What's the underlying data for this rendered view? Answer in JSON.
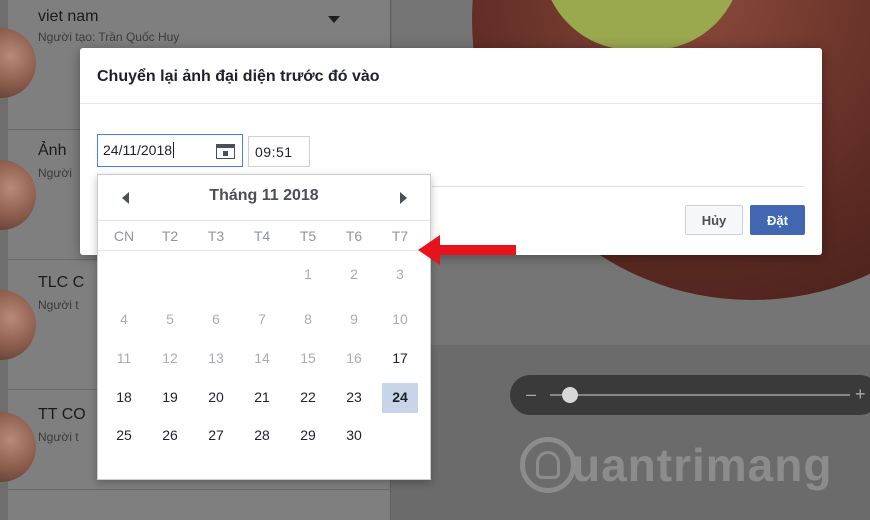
{
  "background": {
    "list_items": [
      {
        "name": "viet nam",
        "sub": "Người tạo: Trần Quốc Huy"
      },
      {
        "name": "Ảnh",
        "sub": "Người"
      },
      {
        "name": "TLC C",
        "sub": "Người t"
      },
      {
        "name": "TT CO",
        "sub": "Người t"
      }
    ],
    "zoom": {
      "minus": "–",
      "plus": "+",
      "level": 0.04
    },
    "watermark": "uantrimang"
  },
  "dialog": {
    "title": "Chuyển lại ảnh đại diện trước đó vào",
    "date_value": "24/11/2018",
    "time_value": "09:51",
    "cancel_label": "Hủy",
    "set_label": "Đặt"
  },
  "calendar": {
    "title": "Tháng 11 2018",
    "weekdays": [
      "CN",
      "T2",
      "T3",
      "T4",
      "T5",
      "T6",
      "T7"
    ],
    "weeks": [
      [
        "",
        "",
        "",
        "",
        "1",
        "2",
        "3"
      ],
      [
        "4",
        "5",
        "6",
        "7",
        "8",
        "9",
        "10"
      ],
      [
        "11",
        "12",
        "13",
        "14",
        "15",
        "16",
        "17"
      ],
      [
        "18",
        "19",
        "20",
        "21",
        "22",
        "23",
        "24"
      ],
      [
        "25",
        "26",
        "27",
        "28",
        "29",
        "30",
        ""
      ]
    ],
    "selected_day": "24",
    "last_disabled_day": 16
  },
  "colors": {
    "accent": "#4267b2",
    "selected_day_bg": "#c8d4e8",
    "arrow": "#e8121c"
  }
}
